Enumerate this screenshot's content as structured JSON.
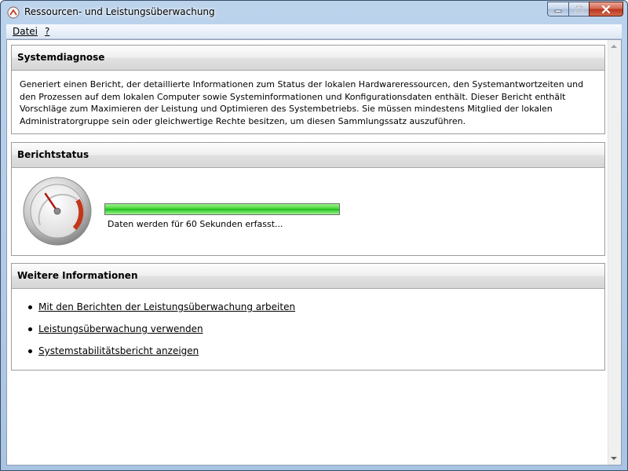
{
  "window": {
    "title": "Ressourcen- und Leistungsüberwachung",
    "icon": "performance-monitor-icon"
  },
  "menu": {
    "file": "Datei",
    "help": "?"
  },
  "system_diagnosis": {
    "heading": "Systemdiagnose",
    "description": "Generiert einen Bericht, der detaillierte Informationen zum Status der lokalen Hardwareressourcen, den Systemantwortzeiten und den Prozessen auf dem lokalen Computer sowie Systeminformationen und Konfigurationsdaten enthält. Dieser Bericht enthält Vorschläge zum Maximieren der Leistung und Optimieren des Systembetriebs. Sie müssen mindestens Mitglied der lokalen Administratorgruppe sein oder gleichwertige Rechte besitzen, um diesen Sammlungssatz auszuführen."
  },
  "report_status": {
    "heading": "Berichtstatus",
    "progress": 1.0,
    "status_text": "Daten werden für 60 Sekunden erfasst...",
    "icon": "gauge-icon"
  },
  "more_info": {
    "heading": "Weitere Informationen",
    "links": [
      "Mit den Berichten der Leistungsüberwachung arbeiten",
      "Leistungsüberwachung verwenden",
      "Systemstabilitätsbericht anzeigen"
    ]
  },
  "colors": {
    "progress_green": "#2fcb2a",
    "gauge_red": "#c4361a"
  }
}
